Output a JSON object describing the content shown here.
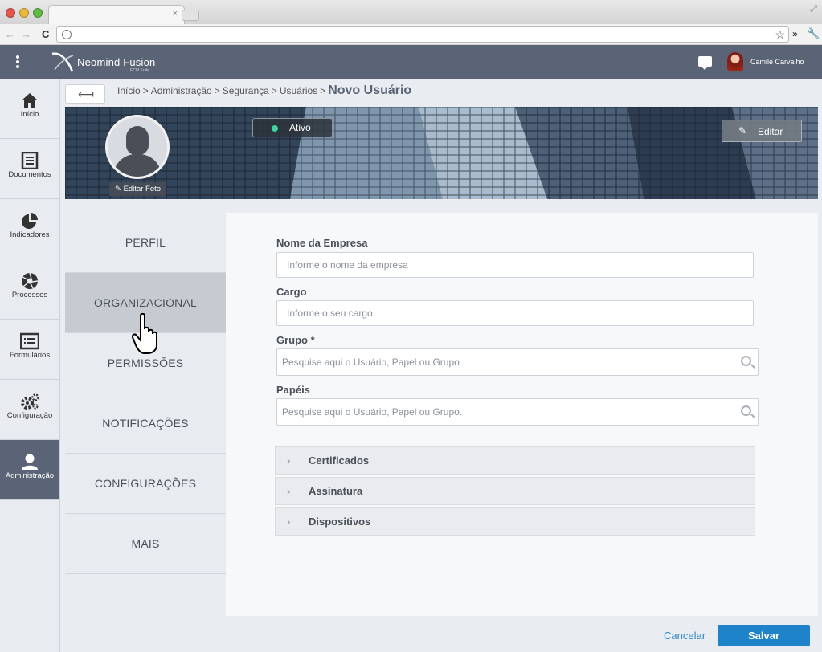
{
  "browser": {
    "tab_close": "×",
    "back": "←",
    "forward": "→",
    "reload": "C",
    "star": "☆",
    "more": "»",
    "wrench": "🔧",
    "resize": "⤢"
  },
  "header": {
    "app_name": "Neomind Fusion",
    "app_subtitle": "ECM Suite",
    "user_name": "Camile Carvalho"
  },
  "sidebar": {
    "items": [
      {
        "label": "Início",
        "icon": "home-icon"
      },
      {
        "label": "Documentos",
        "icon": "document-icon"
      },
      {
        "label": "Indicadores",
        "icon": "pie-chart-icon"
      },
      {
        "label": "Processos",
        "icon": "aperture-icon"
      },
      {
        "label": "Formulários",
        "icon": "form-icon"
      },
      {
        "label": "Configuração",
        "icon": "gears-icon"
      },
      {
        "label": "Administração",
        "icon": "user-icon",
        "active": true
      }
    ]
  },
  "breadcrumb": {
    "back": "⟻",
    "items": [
      "Início",
      "Administração",
      "Segurança",
      "Usuários"
    ],
    "separator": ">",
    "current": "Novo Usuário"
  },
  "profile": {
    "edit_photo": "Editar Foto",
    "status": "Ativo",
    "status_color": "#3fd39a",
    "edit_button": "Editar"
  },
  "tabs": [
    {
      "label": "PERFIL"
    },
    {
      "label": "ORGANIZACIONAL",
      "active": true
    },
    {
      "label": "PERMISSÕES"
    },
    {
      "label": "NOTIFICAÇÕES"
    },
    {
      "label": "CONFIGURAÇÕES"
    },
    {
      "label": "MAIS"
    }
  ],
  "form": {
    "company": {
      "label": "Nome da Empresa",
      "placeholder": "Informe o nome da empresa"
    },
    "role": {
      "label": "Cargo",
      "placeholder": "Informe o seu cargo"
    },
    "group": {
      "label": "Grupo *",
      "placeholder": "Pesquise aqui o Usuário, Papel ou Grupo."
    },
    "papers": {
      "label": "Papéis",
      "placeholder": "Pesquise aqui o Usuário, Papel ou Grupo."
    },
    "sections": [
      "Certificados",
      "Assinatura",
      "Dispositivos"
    ]
  },
  "footer": {
    "cancel": "Cancelar",
    "save": "Salvar"
  },
  "colors": {
    "header": "#5b6477",
    "accent": "#1f83c9",
    "link": "#2f86c8"
  }
}
